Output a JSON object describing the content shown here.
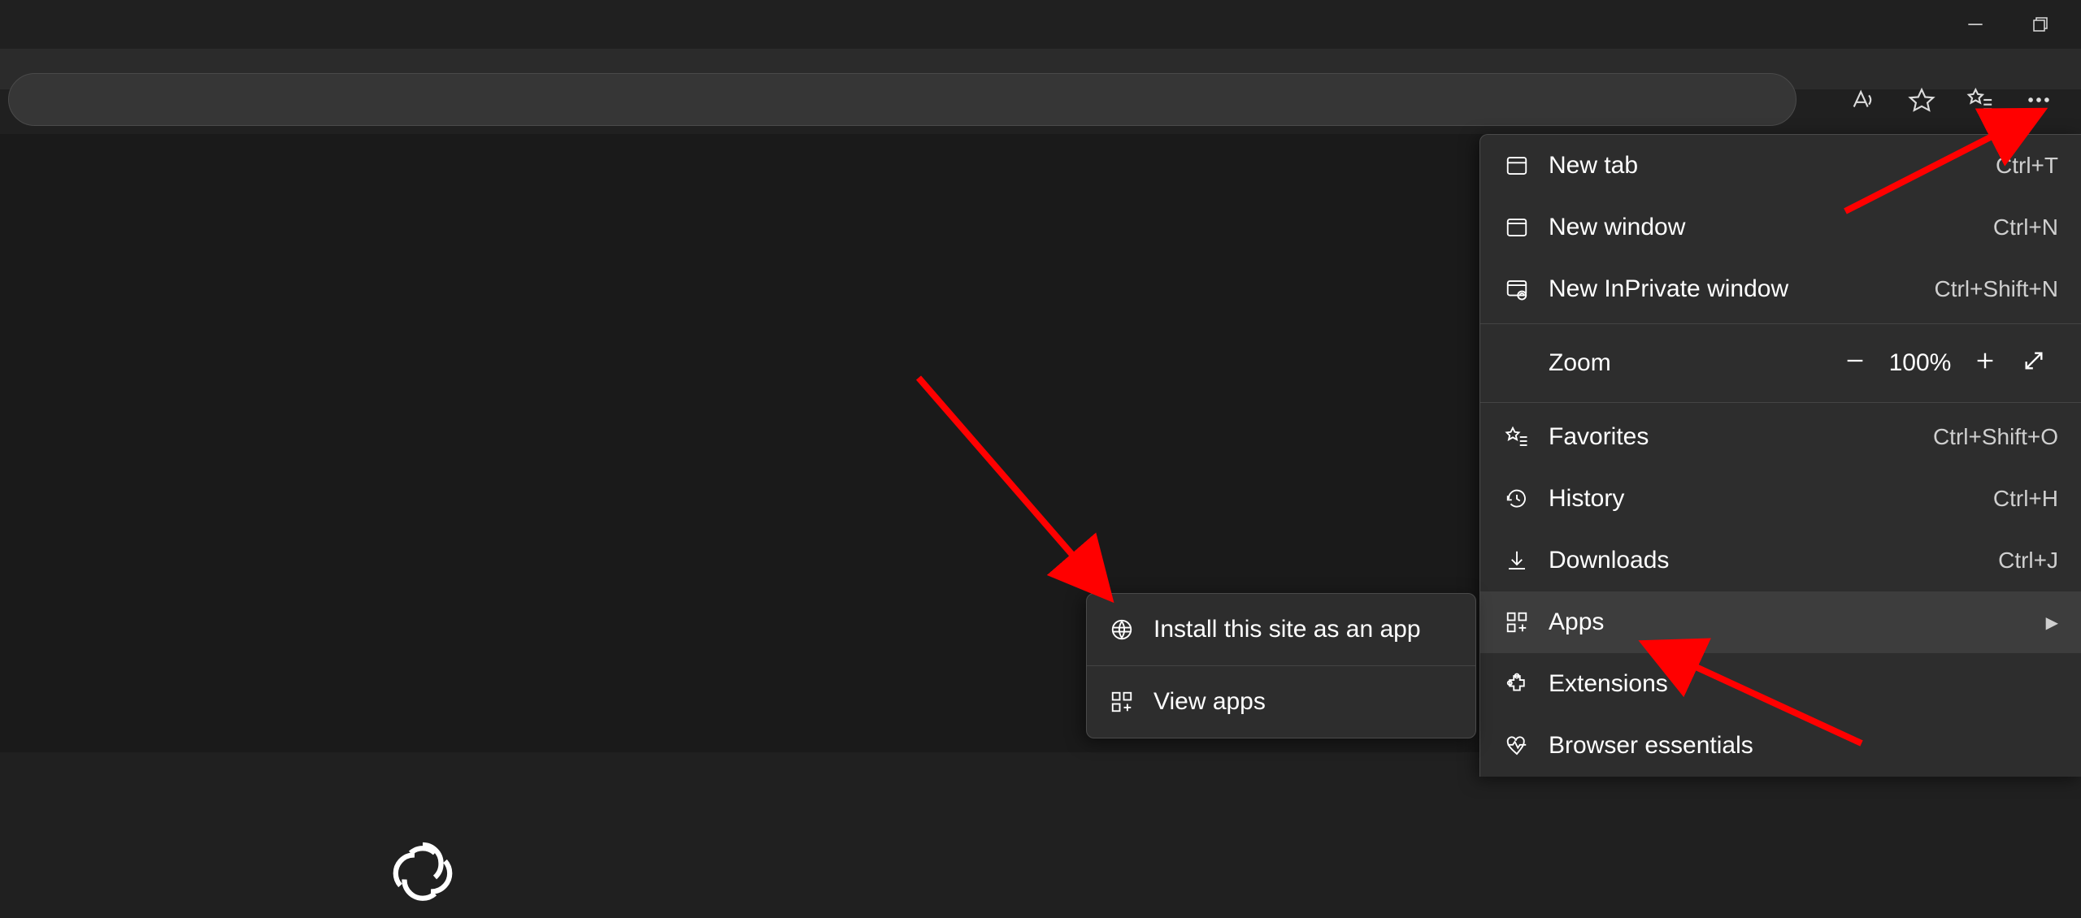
{
  "window": {
    "minimize": "—",
    "maximize": "❐"
  },
  "menu": {
    "new_tab": "New tab",
    "new_tab_sc": "Ctrl+T",
    "new_window": "New window",
    "new_window_sc": "Ctrl+N",
    "new_inprivate": "New InPrivate window",
    "new_inprivate_sc": "Ctrl+Shift+N",
    "zoom_label": "Zoom",
    "zoom_value": "100%",
    "favorites": "Favorites",
    "favorites_sc": "Ctrl+Shift+O",
    "history": "History",
    "history_sc": "Ctrl+H",
    "downloads": "Downloads",
    "downloads_sc": "Ctrl+J",
    "apps": "Apps",
    "extensions": "Extensions",
    "browser_essentials": "Browser essentials"
  },
  "submenu": {
    "install": "Install this site as an app",
    "view_apps": "View apps"
  }
}
